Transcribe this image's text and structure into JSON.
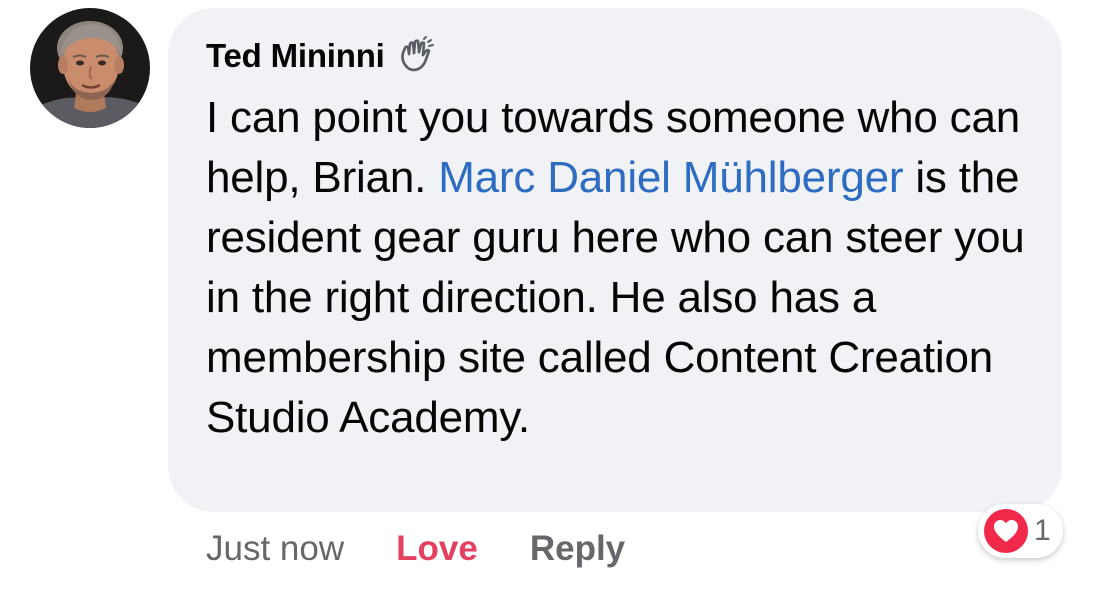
{
  "comment": {
    "author": "Ted Mininni",
    "author_badge_icon": "waving-hand-icon",
    "text_part1": "I can point you towards someone who can help, Brian. ",
    "mention": "Marc Daniel Mühlberger",
    "text_part2": " is the resident gear guru here who can steer you in the right direction. He also has a membership site called Content Creation Studio Academy.",
    "timestamp": "Just now",
    "love_label": "Love",
    "reply_label": "Reply",
    "reaction": {
      "icon": "heart-icon",
      "count": "1"
    }
  },
  "colors": {
    "bubble_bg": "#f0f2f5",
    "mention": "#2d6cc0",
    "love": "#e4405f",
    "muted": "#65676b",
    "heart": "#f02849"
  }
}
